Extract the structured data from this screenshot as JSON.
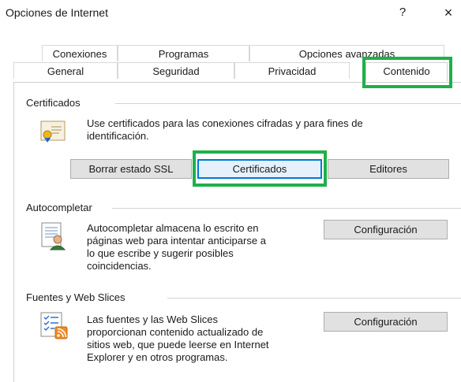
{
  "window": {
    "title": "Opciones de Internet",
    "help_label": "?",
    "close_label": "×"
  },
  "tabs": {
    "top_row": [
      "Conexiones",
      "Programas",
      "Opciones avanzadas"
    ],
    "bottom_row": [
      "General",
      "Seguridad",
      "Privacidad",
      "Contenido"
    ],
    "active": "Contenido"
  },
  "certificates": {
    "group_label": "Certificados",
    "description_line1": "Use certificados para las conexiones cifradas y para fines de",
    "description_line2": "identificación.",
    "clear_ssl_label": "Borrar estado SSL",
    "certificates_label": "Certificados",
    "publishers_label": "Editores"
  },
  "autocomplete": {
    "group_label": "Autocompletar",
    "description_lines": [
      "Autocompletar almacena lo escrito en",
      "páginas web para intentar anticiparse a",
      "lo que escribe y sugerir posibles",
      "coincidencias."
    ],
    "settings_label": "Configuración"
  },
  "feeds": {
    "group_label": "Fuentes y Web Slices",
    "description_lines": [
      "Las fuentes y las Web Slices",
      "proporcionan contenido actualizado de",
      "sitios web, que puede leerse en Internet",
      "Explorer y en otros programas."
    ],
    "settings_label": "Configuración"
  },
  "colors": {
    "highlight": "#1eb04a",
    "focus_border": "#0078d7"
  }
}
